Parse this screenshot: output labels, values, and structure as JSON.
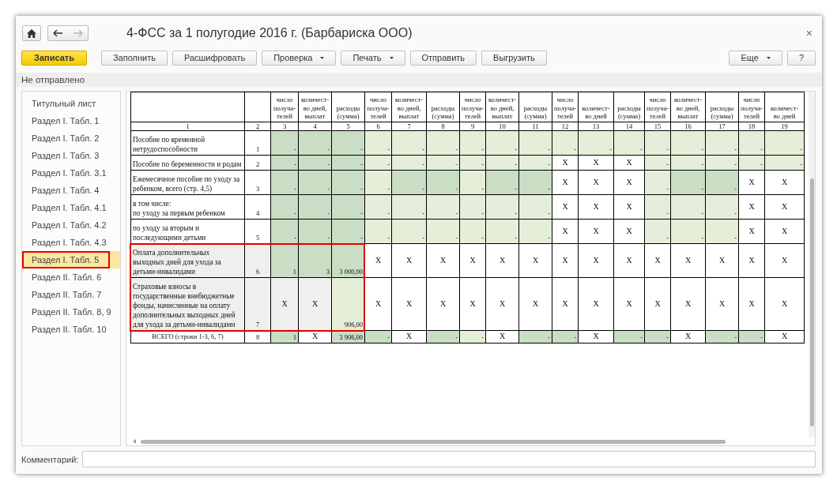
{
  "window": {
    "title": "4-ФСС за 1 полугодие 2016 г. (Барбариска ООО)",
    "close": "×"
  },
  "nav": [
    {
      "kind": "back",
      "disabled": false
    },
    {
      "kind": "forward",
      "disabled": true
    }
  ],
  "toolbar": [
    {
      "label": "Записать",
      "kind": "primary",
      "dropdown": false
    },
    {
      "label": "Заполнить",
      "kind": "plain",
      "dropdown": false
    },
    {
      "label": "Расшифровать",
      "kind": "plain",
      "dropdown": false
    },
    {
      "label": "Проверка",
      "kind": "plain",
      "dropdown": true
    },
    {
      "label": "Печать",
      "kind": "plain",
      "dropdown": true
    },
    {
      "label": "Отправить",
      "kind": "plain",
      "dropdown": false
    },
    {
      "label": "Выгрузить",
      "kind": "plain",
      "dropdown": false
    }
  ],
  "toolbar_right": [
    {
      "label": "Еще",
      "kind": "plain",
      "dropdown": true
    },
    {
      "label": "?",
      "kind": "plain",
      "dropdown": false
    }
  ],
  "status": "Не отправлено",
  "sidebar": {
    "items": [
      {
        "label": "Титульный лист",
        "selected": false
      },
      {
        "label": "Раздел I. Табл. 1",
        "selected": false
      },
      {
        "label": "Раздел I. Табл. 2",
        "selected": false
      },
      {
        "label": "Раздел I. Табл. 3",
        "selected": false
      },
      {
        "label": "Раздел I. Табл. 3.1",
        "selected": false
      },
      {
        "label": "Раздел I. Табл. 4",
        "selected": false
      },
      {
        "label": "Раздел I. Табл. 4.1",
        "selected": false
      },
      {
        "label": "Раздел I. Табл. 4.2",
        "selected": false
      },
      {
        "label": "Раздел I. Табл. 4.3",
        "selected": false
      },
      {
        "label": "Раздел I. Табл. 5",
        "selected": true
      },
      {
        "label": "Раздел II. Табл. 6",
        "selected": false
      },
      {
        "label": "Раздел II. Табл. 7",
        "selected": false
      },
      {
        "label": "Раздел II. Табл. 8, 9",
        "selected": false
      },
      {
        "label": "Раздел II. Табл. 10",
        "selected": false
      }
    ]
  },
  "table": {
    "columns": [
      "",
      "",
      "число\nполуча-\nтелей",
      "количест-\nво дней,\nвыплат",
      "расходы\n(сумма)",
      "число\nполуча-\nтелей",
      "количест-\nво дней,\nвыплат",
      "расходы\n(сумма)",
      "число\nполуча-\nтелей",
      "количест-\nво дней,\nвыплат",
      "расходы\n(сумма)",
      "число\nполуча-\nтелей",
      "количест-\nво дней",
      "расходы\n(сумма)",
      "число\nполуча-\nтелей",
      "количест-\nво дней,\nвыплат",
      "расходы\n(сумма)",
      "число\nполуча-\nтелей",
      "количест-\nво дней"
    ],
    "column_numbers": [
      "1",
      "2",
      "3",
      "4",
      "5",
      "6",
      "7",
      "8",
      "9",
      "10",
      "11",
      "12",
      "13",
      "14",
      "15",
      "16",
      "17",
      "18",
      "19"
    ],
    "rows": [
      {
        "outlined": false,
        "cells": [
          {
            "text": "Пособие по временной нетрудоспособности",
            "kind": "label"
          },
          {
            "text": "1",
            "kind": "code"
          },
          {
            "text": "-",
            "color": "#c9dec5",
            "kind": "value"
          },
          {
            "text": "-",
            "color": "#c9dec5",
            "kind": "value"
          },
          {
            "text": "-",
            "color": "#c9dec5",
            "kind": "value"
          },
          {
            "text": "-",
            "color": "#e5eed9",
            "kind": "value"
          },
          {
            "text": "-",
            "color": "#e5eed9",
            "kind": "value"
          },
          {
            "text": "-",
            "color": "#e5eed9",
            "kind": "value"
          },
          {
            "text": "-",
            "color": "#e5eed9",
            "kind": "value"
          },
          {
            "text": "-",
            "color": "#e5eed9",
            "kind": "value"
          },
          {
            "text": "-",
            "color": "#e5eed9",
            "kind": "value"
          },
          {
            "text": "-",
            "color": "#e5eed9",
            "kind": "value"
          },
          {
            "text": "-",
            "color": "#e5eed9",
            "kind": "value"
          },
          {
            "text": "-",
            "color": "#e5eed9",
            "kind": "value"
          },
          {
            "text": "-",
            "color": "#e5eed9",
            "kind": "value"
          },
          {
            "text": "-",
            "color": "#e5eed9",
            "kind": "value"
          },
          {
            "text": "-",
            "color": "#e5eed9",
            "kind": "value"
          },
          {
            "text": "-",
            "color": "#e5eed9",
            "kind": "value"
          },
          {
            "text": "-",
            "color": "#e5eed9",
            "kind": "value"
          }
        ]
      },
      {
        "outlined": false,
        "cells": [
          {
            "text": "Пособие по беременности и родам",
            "kind": "label"
          },
          {
            "text": "2",
            "kind": "code"
          },
          {
            "text": "-",
            "color": "#c9dec5",
            "kind": "value"
          },
          {
            "text": "-",
            "color": "#c9dec5",
            "kind": "value"
          },
          {
            "text": "-",
            "color": "#c9dec5",
            "kind": "value"
          },
          {
            "text": "-",
            "color": "#e5eed9",
            "kind": "value"
          },
          {
            "text": "-",
            "color": "#e5eed9",
            "kind": "value"
          },
          {
            "text": "-",
            "color": "#e5eed9",
            "kind": "value"
          },
          {
            "text": "-",
            "color": "#e5eed9",
            "kind": "value"
          },
          {
            "text": "-",
            "color": "#e5eed9",
            "kind": "value"
          },
          {
            "text": "-",
            "color": "#e5eed9",
            "kind": "value"
          },
          {
            "text": "X",
            "color": "#ffffff",
            "kind": "mark"
          },
          {
            "text": "X",
            "color": "#ffffff",
            "kind": "mark"
          },
          {
            "text": "X",
            "color": "#ffffff",
            "kind": "mark"
          },
          {
            "text": "-",
            "color": "#e5eed9",
            "kind": "value"
          },
          {
            "text": "-",
            "color": "#e5eed9",
            "kind": "value"
          },
          {
            "text": "-",
            "color": "#e5eed9",
            "kind": "value"
          },
          {
            "text": "-",
            "color": "#e5eed9",
            "kind": "value"
          },
          {
            "text": "-",
            "color": "#e5eed9",
            "kind": "value"
          }
        ]
      },
      {
        "outlined": false,
        "cells": [
          {
            "text": "Ежемесячное пособие по уходу за ребенком, всего (стр. 4,5)",
            "kind": "label"
          },
          {
            "text": "3",
            "kind": "code"
          },
          {
            "text": "-",
            "color": "#c9dec5",
            "kind": "value"
          },
          {
            "text": "-",
            "color": "#c9dec5",
            "kind": "value"
          },
          {
            "text": "-",
            "color": "#c9dec5",
            "kind": "value"
          },
          {
            "text": "-",
            "color": "#e5eed9",
            "kind": "value"
          },
          {
            "text": "-",
            "color": "#c9dec5",
            "kind": "value"
          },
          {
            "text": "-",
            "color": "#c9dec5",
            "kind": "value"
          },
          {
            "text": "-",
            "color": "#e5eed9",
            "kind": "value"
          },
          {
            "text": "-",
            "color": "#c9dec5",
            "kind": "value"
          },
          {
            "text": "-",
            "color": "#c9dec5",
            "kind": "value"
          },
          {
            "text": "X",
            "color": "#ffffff",
            "kind": "mark"
          },
          {
            "text": "X",
            "color": "#ffffff",
            "kind": "mark"
          },
          {
            "text": "X",
            "color": "#ffffff",
            "kind": "mark"
          },
          {
            "text": "-",
            "color": "#e5eed9",
            "kind": "value"
          },
          {
            "text": "-",
            "color": "#c9dec5",
            "kind": "value"
          },
          {
            "text": "-",
            "color": "#c9dec5",
            "kind": "value"
          },
          {
            "text": "X",
            "color": "#ffffff",
            "kind": "mark"
          },
          {
            "text": "X",
            "color": "#ffffff",
            "kind": "mark"
          }
        ]
      },
      {
        "outlined": false,
        "cells": [
          {
            "text": "в том числе:\nпо уходу за первым ребенком",
            "kind": "label"
          },
          {
            "text": "4",
            "kind": "code"
          },
          {
            "text": "-",
            "color": "#c9dec5",
            "kind": "value"
          },
          {
            "text": "-",
            "color": "#c9dec5",
            "kind": "value"
          },
          {
            "text": "-",
            "color": "#c9dec5",
            "kind": "value"
          },
          {
            "text": "-",
            "color": "#e5eed9",
            "kind": "value"
          },
          {
            "text": "-",
            "color": "#e5eed9",
            "kind": "value"
          },
          {
            "text": "-",
            "color": "#e5eed9",
            "kind": "value"
          },
          {
            "text": "-",
            "color": "#e5eed9",
            "kind": "value"
          },
          {
            "text": "-",
            "color": "#e5eed9",
            "kind": "value"
          },
          {
            "text": "-",
            "color": "#e5eed9",
            "kind": "value"
          },
          {
            "text": "X",
            "color": "#ffffff",
            "kind": "mark"
          },
          {
            "text": "X",
            "color": "#ffffff",
            "kind": "mark"
          },
          {
            "text": "X",
            "color": "#ffffff",
            "kind": "mark"
          },
          {
            "text": "-",
            "color": "#e5eed9",
            "kind": "value"
          },
          {
            "text": "-",
            "color": "#e5eed9",
            "kind": "value"
          },
          {
            "text": "-",
            "color": "#e5eed9",
            "kind": "value"
          },
          {
            "text": "X",
            "color": "#ffffff",
            "kind": "mark"
          },
          {
            "text": "X",
            "color": "#ffffff",
            "kind": "mark"
          }
        ]
      },
      {
        "outlined": false,
        "cells": [
          {
            "text": "по уходу за вторым и последующими детьми",
            "kind": "label"
          },
          {
            "text": "5",
            "kind": "code"
          },
          {
            "text": "-",
            "color": "#c9dec5",
            "kind": "value"
          },
          {
            "text": "-",
            "color": "#c9dec5",
            "kind": "value"
          },
          {
            "text": "-",
            "color": "#c9dec5",
            "kind": "value"
          },
          {
            "text": "-",
            "color": "#e5eed9",
            "kind": "value"
          },
          {
            "text": "-",
            "color": "#e5eed9",
            "kind": "value"
          },
          {
            "text": "-",
            "color": "#e5eed9",
            "kind": "value"
          },
          {
            "text": "-",
            "color": "#e5eed9",
            "kind": "value"
          },
          {
            "text": "-",
            "color": "#e5eed9",
            "kind": "value"
          },
          {
            "text": "-",
            "color": "#e5eed9",
            "kind": "value"
          },
          {
            "text": "X",
            "color": "#ffffff",
            "kind": "mark"
          },
          {
            "text": "X",
            "color": "#ffffff",
            "kind": "mark"
          },
          {
            "text": "X",
            "color": "#ffffff",
            "kind": "mark"
          },
          {
            "text": "-",
            "color": "#e5eed9",
            "kind": "value"
          },
          {
            "text": "-",
            "color": "#e5eed9",
            "kind": "value"
          },
          {
            "text": "-",
            "color": "#e5eed9",
            "kind": "value"
          },
          {
            "text": "X",
            "color": "#ffffff",
            "kind": "mark"
          },
          {
            "text": "X",
            "color": "#ffffff",
            "kind": "mark"
          }
        ]
      },
      {
        "outlined": true,
        "cells": [
          {
            "text": "Оплата дополнительных выходных дней для ухода за детьми-инвалидами",
            "kind": "label"
          },
          {
            "text": "6",
            "kind": "code"
          },
          {
            "text": "1",
            "color": "#c9dec5",
            "kind": "value"
          },
          {
            "text": "3",
            "color": "#c9dec5",
            "kind": "value"
          },
          {
            "text": "3 000,00",
            "color": "#c9dec5",
            "kind": "value"
          },
          {
            "text": "X",
            "color": "#ffffff",
            "kind": "mark"
          },
          {
            "text": "X",
            "color": "#ffffff",
            "kind": "mark"
          },
          {
            "text": "X",
            "color": "#ffffff",
            "kind": "mark"
          },
          {
            "text": "X",
            "color": "#ffffff",
            "kind": "mark"
          },
          {
            "text": "X",
            "color": "#ffffff",
            "kind": "mark"
          },
          {
            "text": "X",
            "color": "#ffffff",
            "kind": "mark"
          },
          {
            "text": "X",
            "color": "#ffffff",
            "kind": "mark"
          },
          {
            "text": "X",
            "color": "#ffffff",
            "kind": "mark"
          },
          {
            "text": "X",
            "color": "#ffffff",
            "kind": "mark"
          },
          {
            "text": "X",
            "color": "#ffffff",
            "kind": "mark"
          },
          {
            "text": "X",
            "color": "#ffffff",
            "kind": "mark"
          },
          {
            "text": "X",
            "color": "#ffffff",
            "kind": "mark"
          },
          {
            "text": "X",
            "color": "#ffffff",
            "kind": "mark"
          },
          {
            "text": "X",
            "color": "#ffffff",
            "kind": "mark"
          }
        ]
      },
      {
        "outlined": true,
        "cells": [
          {
            "text": "Страховые взносы в государственные внебюджетные фонды, начисленные на оплату дополнительных выходных дней для ухода за детьми-инвалидами",
            "kind": "label"
          },
          {
            "text": "7",
            "kind": "code"
          },
          {
            "text": "X",
            "color": "#f0f0f0",
            "kind": "mark"
          },
          {
            "text": "X",
            "color": "#f0f0f0",
            "kind": "mark"
          },
          {
            "text": "906,00",
            "color": "#e5eed9",
            "kind": "value"
          },
          {
            "text": "X",
            "color": "#ffffff",
            "kind": "mark"
          },
          {
            "text": "X",
            "color": "#ffffff",
            "kind": "mark"
          },
          {
            "text": "X",
            "color": "#ffffff",
            "kind": "mark"
          },
          {
            "text": "X",
            "color": "#ffffff",
            "kind": "mark"
          },
          {
            "text": "X",
            "color": "#ffffff",
            "kind": "mark"
          },
          {
            "text": "X",
            "color": "#ffffff",
            "kind": "mark"
          },
          {
            "text": "X",
            "color": "#ffffff",
            "kind": "mark"
          },
          {
            "text": "X",
            "color": "#ffffff",
            "kind": "mark"
          },
          {
            "text": "X",
            "color": "#ffffff",
            "kind": "mark"
          },
          {
            "text": "X",
            "color": "#ffffff",
            "kind": "mark"
          },
          {
            "text": "X",
            "color": "#ffffff",
            "kind": "mark"
          },
          {
            "text": "X",
            "color": "#ffffff",
            "kind": "mark"
          },
          {
            "text": "X",
            "color": "#ffffff",
            "kind": "mark"
          },
          {
            "text": "X",
            "color": "#ffffff",
            "kind": "mark"
          }
        ]
      },
      {
        "outlined": false,
        "cells": [
          {
            "text": "ВСЕГО (строки 1-3, 6, 7)",
            "kind": "total"
          },
          {
            "text": "8",
            "kind": "code"
          },
          {
            "text": "1",
            "color": "#c9dec5",
            "kind": "value"
          },
          {
            "text": "X",
            "color": "#ffffff",
            "kind": "mark"
          },
          {
            "text": "3 906,00",
            "color": "#c9dec5",
            "kind": "value"
          },
          {
            "text": "-",
            "color": "#c9dec5",
            "kind": "value"
          },
          {
            "text": "X",
            "color": "#ffffff",
            "kind": "mark"
          },
          {
            "text": "-",
            "color": "#c9dec5",
            "kind": "value"
          },
          {
            "text": "-",
            "color": "#e5eed9",
            "kind": "value"
          },
          {
            "text": "X",
            "color": "#ffffff",
            "kind": "mark"
          },
          {
            "text": "-",
            "color": "#c9dec5",
            "kind": "value"
          },
          {
            "text": "-",
            "color": "#c9dec5",
            "kind": "value"
          },
          {
            "text": "X",
            "color": "#ffffff",
            "kind": "mark"
          },
          {
            "text": "-",
            "color": "#c9dec5",
            "kind": "value"
          },
          {
            "text": "-",
            "color": "#c9dec5",
            "kind": "value"
          },
          {
            "text": "X",
            "color": "#ffffff",
            "kind": "mark"
          },
          {
            "text": "-",
            "color": "#c9dec5",
            "kind": "value"
          },
          {
            "text": "-",
            "color": "#c9dec5",
            "kind": "value"
          },
          {
            "text": "X",
            "color": "#ffffff",
            "kind": "mark"
          }
        ]
      }
    ]
  },
  "comment": {
    "label": "Комментарий:"
  }
}
